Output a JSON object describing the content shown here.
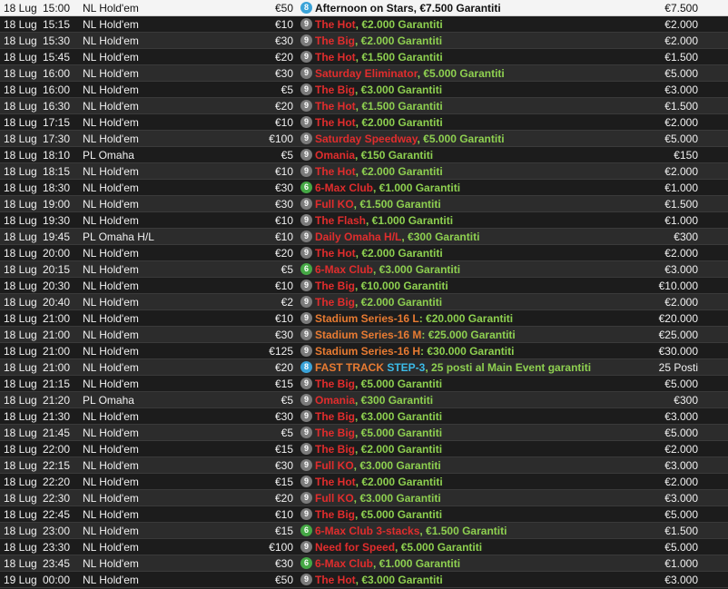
{
  "colors": {
    "red": "#e02d2d",
    "green": "#8ed050",
    "orange": "#e87b32",
    "cyan": "#3cbbe8",
    "badge_grey": "#7b7b7b",
    "badge_green": "#45a845",
    "badge_blue": "#3aa3d8"
  },
  "rows": [
    {
      "date": "18 Lug",
      "time": "15:00",
      "game": "NL Hold'em",
      "buyin": "€50",
      "badge": "8",
      "badge_color": "blue",
      "title": [
        {
          "t": "Afternoon on Stars",
          "c": "black"
        },
        {
          "t": ", €7.500 Garantiti",
          "c": "black"
        }
      ],
      "prize": "€7.500",
      "highlight": true
    },
    {
      "date": "18 Lug",
      "time": "15:15",
      "game": "NL Hold'em",
      "buyin": "€10",
      "badge": "9",
      "badge_color": "grey",
      "title": [
        {
          "t": "The Hot",
          "c": "red"
        },
        {
          "t": ", €2.000 Garantiti",
          "c": "green"
        }
      ],
      "prize": "€2.000"
    },
    {
      "date": "18 Lug",
      "time": "15:30",
      "game": "NL Hold'em",
      "buyin": "€30",
      "badge": "9",
      "badge_color": "grey",
      "title": [
        {
          "t": "The Big",
          "c": "red"
        },
        {
          "t": ", €2.000 Garantiti",
          "c": "green"
        }
      ],
      "prize": "€2.000"
    },
    {
      "date": "18 Lug",
      "time": "15:45",
      "game": "NL Hold'em",
      "buyin": "€20",
      "badge": "9",
      "badge_color": "grey",
      "title": [
        {
          "t": "The Hot",
          "c": "red"
        },
        {
          "t": ", €1.500 Garantiti",
          "c": "green"
        }
      ],
      "prize": "€1.500"
    },
    {
      "date": "18 Lug",
      "time": "16:00",
      "game": "NL Hold'em",
      "buyin": "€30",
      "badge": "9",
      "badge_color": "grey",
      "title": [
        {
          "t": "Saturday Eliminator",
          "c": "red"
        },
        {
          "t": ", €5.000 Garantiti",
          "c": "green"
        }
      ],
      "prize": "€5.000"
    },
    {
      "date": "18 Lug",
      "time": "16:00",
      "game": "NL Hold'em",
      "buyin": "€5",
      "badge": "9",
      "badge_color": "grey",
      "title": [
        {
          "t": "The Big",
          "c": "red"
        },
        {
          "t": ", €3.000 Garantiti",
          "c": "green"
        }
      ],
      "prize": "€3.000"
    },
    {
      "date": "18 Lug",
      "time": "16:30",
      "game": "NL Hold'em",
      "buyin": "€20",
      "badge": "9",
      "badge_color": "grey",
      "title": [
        {
          "t": "The Hot",
          "c": "red"
        },
        {
          "t": ", €1.500 Garantiti",
          "c": "green"
        }
      ],
      "prize": "€1.500"
    },
    {
      "date": "18 Lug",
      "time": "17:15",
      "game": "NL Hold'em",
      "buyin": "€10",
      "badge": "9",
      "badge_color": "grey",
      "title": [
        {
          "t": "The Hot",
          "c": "red"
        },
        {
          "t": ", €2.000 Garantiti",
          "c": "green"
        }
      ],
      "prize": "€2.000"
    },
    {
      "date": "18 Lug",
      "time": "17:30",
      "game": "NL Hold'em",
      "buyin": "€100",
      "badge": "9",
      "badge_color": "grey",
      "title": [
        {
          "t": "Saturday Speedway",
          "c": "red"
        },
        {
          "t": ", €5.000 Garantiti",
          "c": "green"
        }
      ],
      "prize": "€5.000"
    },
    {
      "date": "18 Lug",
      "time": "18:10",
      "game": "PL Omaha",
      "buyin": "€5",
      "badge": "9",
      "badge_color": "grey",
      "title": [
        {
          "t": "Omania",
          "c": "red"
        },
        {
          "t": ", €150 Garantiti",
          "c": "green"
        }
      ],
      "prize": "€150"
    },
    {
      "date": "18 Lug",
      "time": "18:15",
      "game": "NL Hold'em",
      "buyin": "€10",
      "badge": "9",
      "badge_color": "grey",
      "title": [
        {
          "t": "The Hot",
          "c": "red"
        },
        {
          "t": ", €2.000 Garantiti",
          "c": "green"
        }
      ],
      "prize": "€2.000"
    },
    {
      "date": "18 Lug",
      "time": "18:30",
      "game": "NL Hold'em",
      "buyin": "€30",
      "badge": "6",
      "badge_color": "green",
      "title": [
        {
          "t": "6-Max Club",
          "c": "red"
        },
        {
          "t": ", €1.000 Garantiti",
          "c": "green"
        }
      ],
      "prize": "€1.000"
    },
    {
      "date": "18 Lug",
      "time": "19:00",
      "game": "NL Hold'em",
      "buyin": "€30",
      "badge": "9",
      "badge_color": "grey",
      "title": [
        {
          "t": "Full KO",
          "c": "red"
        },
        {
          "t": ", €1.500 Garantiti",
          "c": "green"
        }
      ],
      "prize": "€1.500"
    },
    {
      "date": "18 Lug",
      "time": "19:30",
      "game": "NL Hold'em",
      "buyin": "€10",
      "badge": "9",
      "badge_color": "grey",
      "title": [
        {
          "t": "The Flash",
          "c": "red"
        },
        {
          "t": ", €1.000 Garantiti",
          "c": "green"
        }
      ],
      "prize": "€1.000"
    },
    {
      "date": "18 Lug",
      "time": "19:45",
      "game": "PL Omaha H/L",
      "buyin": "€10",
      "badge": "9",
      "badge_color": "grey",
      "title": [
        {
          "t": "Daily Omaha H/L",
          "c": "red"
        },
        {
          "t": ", €300 Garantiti",
          "c": "green"
        }
      ],
      "prize": "€300"
    },
    {
      "date": "18 Lug",
      "time": "20:00",
      "game": "NL Hold'em",
      "buyin": "€20",
      "badge": "9",
      "badge_color": "grey",
      "title": [
        {
          "t": "The Hot",
          "c": "red"
        },
        {
          "t": ", €2.000 Garantiti",
          "c": "green"
        }
      ],
      "prize": "€2.000"
    },
    {
      "date": "18 Lug",
      "time": "20:15",
      "game": "NL Hold'em",
      "buyin": "€5",
      "badge": "6",
      "badge_color": "green",
      "title": [
        {
          "t": "6-Max Club",
          "c": "red"
        },
        {
          "t": ", €3.000 Garantiti",
          "c": "green"
        }
      ],
      "prize": "€3.000"
    },
    {
      "date": "18 Lug",
      "time": "20:30",
      "game": "NL Hold'em",
      "buyin": "€10",
      "badge": "9",
      "badge_color": "grey",
      "title": [
        {
          "t": "The Big",
          "c": "red"
        },
        {
          "t": ", €10.000 Garantiti",
          "c": "green"
        }
      ],
      "prize": "€10.000"
    },
    {
      "date": "18 Lug",
      "time": "20:40",
      "game": "NL Hold'em",
      "buyin": "€2",
      "badge": "9",
      "badge_color": "grey",
      "title": [
        {
          "t": "The Big",
          "c": "red"
        },
        {
          "t": ", €2.000 Garantiti",
          "c": "green"
        }
      ],
      "prize": "€2.000"
    },
    {
      "date": "18 Lug",
      "time": "21:00",
      "game": "NL Hold'em",
      "buyin": "€10",
      "badge": "9",
      "badge_color": "grey",
      "title": [
        {
          "t": "Stadium Series-16 L",
          "c": "orange"
        },
        {
          "t": ": €20.000 Garantiti",
          "c": "green"
        }
      ],
      "prize": "€20.000"
    },
    {
      "date": "18 Lug",
      "time": "21:00",
      "game": "NL Hold'em",
      "buyin": "€30",
      "badge": "9",
      "badge_color": "grey",
      "title": [
        {
          "t": "Stadium Series-16 M",
          "c": "orange"
        },
        {
          "t": ": €25.000 Garantiti",
          "c": "green"
        }
      ],
      "prize": "€25.000"
    },
    {
      "date": "18 Lug",
      "time": "21:00",
      "game": "NL Hold'em",
      "buyin": "€125",
      "badge": "9",
      "badge_color": "grey",
      "title": [
        {
          "t": "Stadium Series-16 H",
          "c": "orange"
        },
        {
          "t": ": €30.000 Garantiti",
          "c": "green"
        }
      ],
      "prize": "€30.000"
    },
    {
      "date": "18 Lug",
      "time": "21:00",
      "game": "NL Hold'em",
      "buyin": "€20",
      "badge": "8",
      "badge_color": "blue",
      "title": [
        {
          "t": "FAST TRACK ",
          "c": "orange"
        },
        {
          "t": "STEP-3",
          "c": "cyan"
        },
        {
          "t": ", 25 posti al Main Event garantiti",
          "c": "green"
        }
      ],
      "prize": "25 Posti"
    },
    {
      "date": "18 Lug",
      "time": "21:15",
      "game": "NL Hold'em",
      "buyin": "€15",
      "badge": "9",
      "badge_color": "grey",
      "title": [
        {
          "t": "The Big",
          "c": "red"
        },
        {
          "t": ", €5.000 Garantiti",
          "c": "green"
        }
      ],
      "prize": "€5.000"
    },
    {
      "date": "18 Lug",
      "time": "21:20",
      "game": "PL Omaha",
      "buyin": "€5",
      "badge": "9",
      "badge_color": "grey",
      "title": [
        {
          "t": "Omania",
          "c": "red"
        },
        {
          "t": ", €300 Garantiti",
          "c": "green"
        }
      ],
      "prize": "€300"
    },
    {
      "date": "18 Lug",
      "time": "21:30",
      "game": "NL Hold'em",
      "buyin": "€30",
      "badge": "9",
      "badge_color": "grey",
      "title": [
        {
          "t": "The Big",
          "c": "red"
        },
        {
          "t": ", €3.000 Garantiti",
          "c": "green"
        }
      ],
      "prize": "€3.000"
    },
    {
      "date": "18 Lug",
      "time": "21:45",
      "game": "NL Hold'em",
      "buyin": "€5",
      "badge": "9",
      "badge_color": "grey",
      "title": [
        {
          "t": "The Big",
          "c": "red"
        },
        {
          "t": ", €5.000 Garantiti",
          "c": "green"
        }
      ],
      "prize": "€5.000"
    },
    {
      "date": "18 Lug",
      "time": "22:00",
      "game": "NL Hold'em",
      "buyin": "€15",
      "badge": "9",
      "badge_color": "grey",
      "title": [
        {
          "t": "The Big",
          "c": "red"
        },
        {
          "t": ", €2.000 Garantiti",
          "c": "green"
        }
      ],
      "prize": "€2.000"
    },
    {
      "date": "18 Lug",
      "time": "22:15",
      "game": "NL Hold'em",
      "buyin": "€30",
      "badge": "9",
      "badge_color": "grey",
      "title": [
        {
          "t": "Full KO",
          "c": "red"
        },
        {
          "t": ", €3.000 Garantiti",
          "c": "green"
        }
      ],
      "prize": "€3.000"
    },
    {
      "date": "18 Lug",
      "time": "22:20",
      "game": "NL Hold'em",
      "buyin": "€15",
      "badge": "9",
      "badge_color": "grey",
      "title": [
        {
          "t": "The Hot",
          "c": "red"
        },
        {
          "t": ", €2.000 Garantiti",
          "c": "green"
        }
      ],
      "prize": "€2.000"
    },
    {
      "date": "18 Lug",
      "time": "22:30",
      "game": "NL Hold'em",
      "buyin": "€20",
      "badge": "9",
      "badge_color": "grey",
      "title": [
        {
          "t": "Full KO",
          "c": "red"
        },
        {
          "t": ", €3.000 Garantiti",
          "c": "green"
        }
      ],
      "prize": "€3.000"
    },
    {
      "date": "18 Lug",
      "time": "22:45",
      "game": "NL Hold'em",
      "buyin": "€10",
      "badge": "9",
      "badge_color": "grey",
      "title": [
        {
          "t": "The Big",
          "c": "red"
        },
        {
          "t": ", €5.000 Garantiti",
          "c": "green"
        }
      ],
      "prize": "€5.000"
    },
    {
      "date": "18 Lug",
      "time": "23:00",
      "game": "NL Hold'em",
      "buyin": "€15",
      "badge": "6",
      "badge_color": "green",
      "title": [
        {
          "t": "6-Max Club 3-stacks",
          "c": "red"
        },
        {
          "t": ", €1.500 Garantiti",
          "c": "green"
        }
      ],
      "prize": "€1.500"
    },
    {
      "date": "18 Lug",
      "time": "23:30",
      "game": "NL Hold'em",
      "buyin": "€100",
      "badge": "9",
      "badge_color": "grey",
      "title": [
        {
          "t": "Need for Speed",
          "c": "red"
        },
        {
          "t": ", €5.000 Garantiti",
          "c": "green"
        }
      ],
      "prize": "€5.000"
    },
    {
      "date": "18 Lug",
      "time": "23:45",
      "game": "NL Hold'em",
      "buyin": "€30",
      "badge": "6",
      "badge_color": "green",
      "title": [
        {
          "t": "6-Max Club",
          "c": "red"
        },
        {
          "t": ", €1.000 Garantiti",
          "c": "green"
        }
      ],
      "prize": "€1.000"
    },
    {
      "date": "19 Lug",
      "time": "00:00",
      "game": "NL Hold'em",
      "buyin": "€50",
      "badge": "9",
      "badge_color": "grey",
      "title": [
        {
          "t": "The Hot",
          "c": "red"
        },
        {
          "t": ", €3.000 Garantiti",
          "c": "green"
        }
      ],
      "prize": "€3.000"
    }
  ]
}
